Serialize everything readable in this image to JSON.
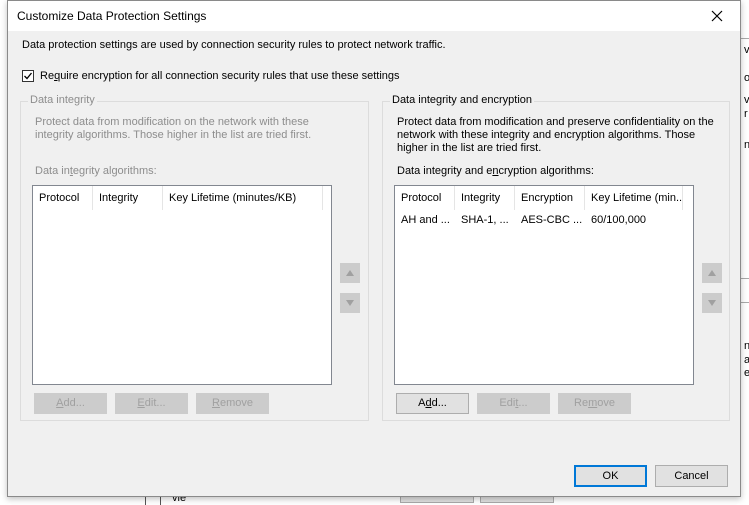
{
  "dialog": {
    "title": "Customize Data Protection Settings",
    "intro": "Data protection settings are used by connection security rules to protect network traffic.",
    "require_encryption": {
      "checked": true,
      "label_pre": "Re",
      "label_u": "q",
      "label_post": "uire encryption for all connection security rules that use these settings"
    }
  },
  "integrity": {
    "title": "Data integrity",
    "description": "Protect data from modification on the network with these integrity algorithms. Those higher in the list are tried first.",
    "list_label_pre": "Data in",
    "list_label_u": "t",
    "list_label_post": "egrity algorithms:",
    "columns": [
      "Protocol",
      "Integrity",
      "Key Lifetime (minutes/KB)"
    ],
    "rows": [],
    "buttons": {
      "add_pre": "",
      "add_u": "A",
      "add_post": "dd...",
      "edit_pre": "",
      "edit_u": "E",
      "edit_post": "dit...",
      "remove_pre": "",
      "remove_u": "R",
      "remove_post": "emove"
    }
  },
  "encryption": {
    "title": "Data integrity and encryption",
    "description": "Protect data from modification and preserve confidentiality on the network with these integrity and encryption algorithms.  Those higher in the list are tried first.",
    "list_label_pre": "Data integrity and e",
    "list_label_u": "n",
    "list_label_post": "cryption algorithms:",
    "columns": [
      "Protocol",
      "Integrity",
      "Encryption",
      "Key Lifetime (min..."
    ],
    "rows": [
      [
        "AH and ...",
        "SHA-1, ...",
        "AES-CBC ...",
        "60/100,000"
      ]
    ],
    "buttons": {
      "add_pre": "A",
      "add_u": "d",
      "add_post": "d...",
      "edit_pre": "Edi",
      "edit_u": "t",
      "edit_post": "...",
      "remove_pre": "Re",
      "remove_u": "m",
      "remove_post": "ove"
    }
  },
  "footer": {
    "ok": "OK",
    "cancel": "Cancel"
  },
  "background": {
    "fragments": [
      "v",
      "o",
      "vi",
      "r i",
      "nc",
      "n a",
      "a",
      "ea"
    ],
    "bottom_text": "vie"
  }
}
